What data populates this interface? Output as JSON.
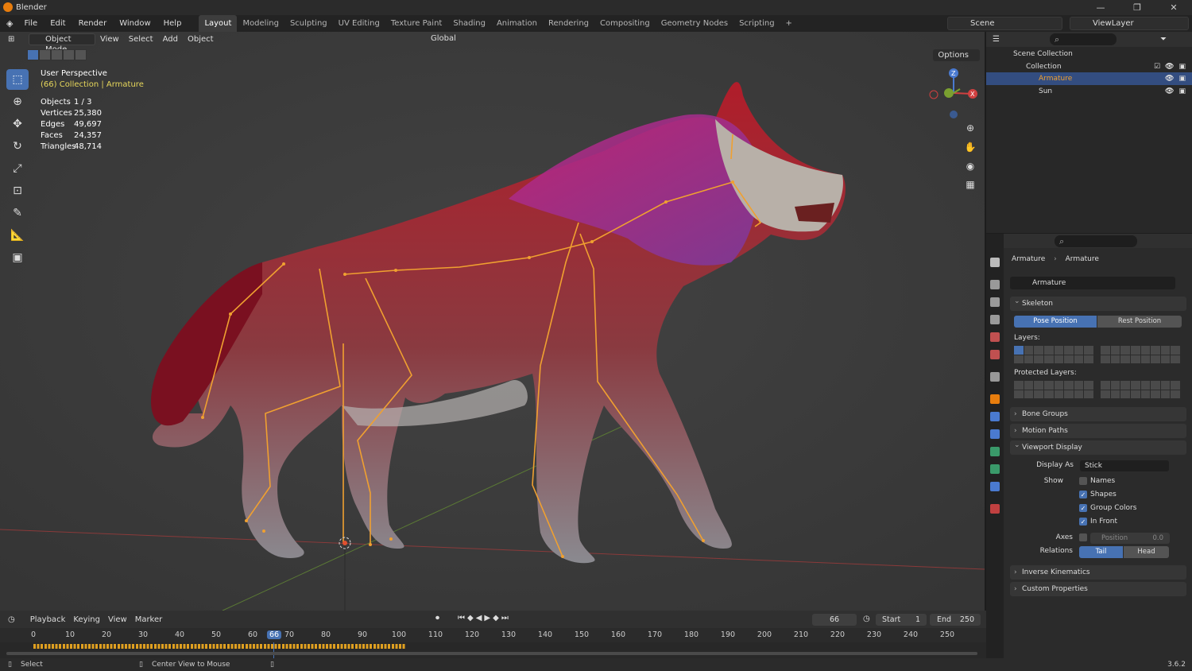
{
  "app": {
    "title": "Blender"
  },
  "menu": [
    "File",
    "Edit",
    "Render",
    "Window",
    "Help"
  ],
  "workspaces": [
    "Layout",
    "Modeling",
    "Sculpting",
    "UV Editing",
    "Texture Paint",
    "Shading",
    "Animation",
    "Rendering",
    "Compositing",
    "Geometry Nodes",
    "Scripting"
  ],
  "scene": {
    "name": "Scene",
    "view_layer": "ViewLayer"
  },
  "viewport": {
    "mode": "Object Mode",
    "menus": [
      "View",
      "Select",
      "Add",
      "Object"
    ],
    "orientation": "Global",
    "options_label": "Options",
    "perspective": "User Perspective",
    "collection_info": "(66) Collection | Armature",
    "stats": [
      {
        "k": "Objects",
        "v": "1 / 3"
      },
      {
        "k": "Vertices",
        "v": "25,380"
      },
      {
        "k": "Edges",
        "v": "49,697"
      },
      {
        "k": "Faces",
        "v": "24,357"
      },
      {
        "k": "Triangles",
        "v": "48,714"
      }
    ]
  },
  "outliner": {
    "scene_collection": "Scene Collection",
    "collection": "Collection",
    "armature": "Armature",
    "sun": "Sun"
  },
  "properties": {
    "breadcrumb_object": "Armature",
    "breadcrumb_data": "Armature",
    "data_name": "Armature",
    "skeleton": "Skeleton",
    "pose_position": "Pose Position",
    "rest_position": "Rest Position",
    "layers": "Layers:",
    "protected_layers": "Protected Layers:",
    "bone_groups": "Bone Groups",
    "motion_paths": "Motion Paths",
    "viewport_display": "Viewport Display",
    "display_as_label": "Display As",
    "display_as_value": "Stick",
    "show_label": "Show",
    "names": "Names",
    "shapes": "Shapes",
    "group_colors": "Group Colors",
    "in_front": "In Front",
    "axes_label": "Axes",
    "position_label": "Position",
    "position_value": "0.0",
    "relations_label": "Relations",
    "tail": "Tail",
    "head": "Head",
    "inverse_kinematics": "Inverse Kinematics",
    "custom_properties": "Custom Properties"
  },
  "timeline": {
    "menus": [
      "Playback",
      "Keying",
      "View",
      "Marker"
    ],
    "current_frame": "66",
    "start_label": "Start",
    "start": "1",
    "end_label": "End",
    "end": "250",
    "ticks": [
      "0",
      "10",
      "20",
      "30",
      "40",
      "50",
      "60",
      "66",
      "70",
      "80",
      "90",
      "100",
      "110",
      "120",
      "130",
      "140",
      "150",
      "160",
      "170",
      "180",
      "190",
      "200",
      "210",
      "220",
      "230",
      "240",
      "250"
    ]
  },
  "status": {
    "left": "Select",
    "middle": "Center View to Mouse",
    "version": "3.6.2"
  },
  "colors": {
    "accent": "#4772b3",
    "bone": "#f0a030",
    "selected_text": "#e7d75b"
  }
}
